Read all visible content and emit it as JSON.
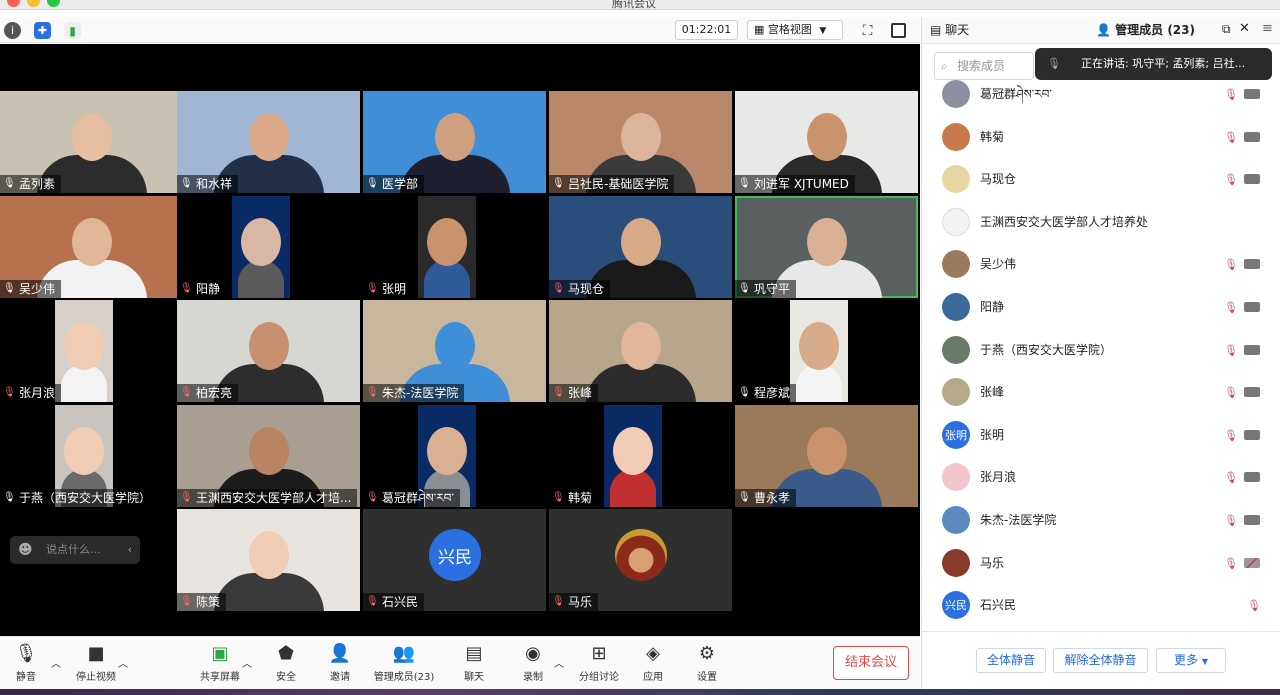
{
  "window": {
    "title": "腾讯会议"
  },
  "toolbar": {
    "timer": "01:22:01",
    "view_label": "宫格视图"
  },
  "tiles": [
    {
      "name": "孟列素",
      "bg": "#c9c2b3",
      "skin": "#e6bfa3",
      "cloth": "#2c2c2c",
      "mic": "on"
    },
    {
      "name": "和水祥",
      "bg": "#9fb7d4",
      "skin": "#d9a98a",
      "cloth": "#222f48",
      "mic": "on"
    },
    {
      "name": "医学部",
      "bg": "#3f8ed6",
      "skin": "#cfa080",
      "cloth": "#1e2030",
      "mic": "on"
    },
    {
      "name": "吕社民-基础医学院",
      "bg": "#b9876a",
      "skin": "#dcb39b",
      "cloth": "#3a3a3a",
      "mic": "on"
    },
    {
      "name": "刘进军 XJTUMED",
      "bg": "#e8e8e6",
      "skin": "#c9936e",
      "cloth": "#2a2a2a",
      "mic": "on"
    },
    {
      "name": "吴少伟",
      "bg": "#b8714f",
      "skin": "#e0b899",
      "cloth": "#f2f2f2",
      "mic": "on"
    },
    {
      "name": "阳静",
      "bg": "#0a2a66",
      "skin": "#d8b8a4",
      "cloth": "#5a5a5a",
      "mic": "off"
    },
    {
      "name": "张明",
      "bg": "#2a2a2a",
      "skin": "#c9936e",
      "cloth": "#2f5a9a",
      "mic": "off"
    },
    {
      "name": "马现仓",
      "bg": "#2b4d7c",
      "skin": "#d8ab88",
      "cloth": "#1a1a1a",
      "mic": "off"
    },
    {
      "name": "巩守平",
      "bg": "#5a5f60",
      "skin": "#d9b192",
      "cloth": "#e8e8e8",
      "mic": "on"
    },
    {
      "name": "张月浪",
      "bg": "#d7cfc9",
      "skin": "#f0cdb4",
      "cloth": "#f3f3f3",
      "mic": "off"
    },
    {
      "name": "柏宏亮",
      "bg": "#d6d6d2",
      "skin": "#c79071",
      "cloth": "#2d2d2d",
      "mic": "off"
    },
    {
      "name": "朱杰-法医学院",
      "bg": "#c8b79c",
      "skin": "#3f8fd8",
      "cloth": "#3f8fd8",
      "mic": "off"
    },
    {
      "name": "张峰",
      "bg": "#b7a58c",
      "skin": "#e0b79a",
      "cloth": "#2b2b2b",
      "mic": "off"
    },
    {
      "name": "程彦斌",
      "bg": "#e9e7e2",
      "skin": "#d8ab88",
      "cloth": "#f4f4f4",
      "mic": "on"
    },
    {
      "name": "于燕（西安交大医学院）",
      "bg": "#c9c4c0",
      "skin": "#f0cdb4",
      "cloth": "#6a6a6a",
      "mic": "on"
    },
    {
      "name": "王渊西安交大医学部人才培...",
      "bg": "#a89e92",
      "skin": "#b88462",
      "cloth": "#1c1c1c",
      "mic": "off"
    },
    {
      "name": "葛冠群ཤེས་རབ་",
      "bg": "#0a2a66",
      "skin": "#d9b192",
      "cloth": "#8a8f96",
      "mic": "off"
    },
    {
      "name": "韩菊",
      "bg": "#0a2a66",
      "skin": "#f0cdb4",
      "cloth": "#c03030",
      "mic": "off"
    },
    {
      "name": "曹永孝",
      "bg": "#9a7a5a",
      "skin": "#c9936e",
      "cloth": "#3a5a8a",
      "mic": "on"
    },
    {
      "name": "陈策",
      "bg": "#e8e3de",
      "skin": "#f0cdb4",
      "cloth": "#3a3a3a",
      "mic": "off"
    },
    {
      "name": "石兴民",
      "bg": "#2f2f2f",
      "avatar": "兴民",
      "mic": "off"
    },
    {
      "name": "马乐",
      "bg": "#2f2f2f",
      "avatar_img": true,
      "mic": "off"
    }
  ],
  "chat": {
    "placeholder": "说点什么..."
  },
  "bottombar": {
    "mute": "静音",
    "video": "停止视频",
    "share": "共享屏幕",
    "security": "安全",
    "invite": "邀请",
    "members": "管理成员(23)",
    "chat": "聊天",
    "record": "录制",
    "breakout": "分组讨论",
    "apps": "应用",
    "settings": "设置",
    "end": "结束会议"
  },
  "panel": {
    "chat_tab": "聊天",
    "members_tab": "管理成员 (23)",
    "search_placeholder": "搜索成员",
    "speaking": "正在讲话: 巩守平; 孟列素; 吕社...",
    "mute_all": "全体静音",
    "unmute_all": "解除全体静音",
    "more": "更多"
  },
  "members": [
    {
      "name": "葛冠群ཤེས་རབ་",
      "color": "#8b8fa0",
      "cam": "on"
    },
    {
      "name": "韩菊",
      "color": "#c97a4c",
      "cam": "on"
    },
    {
      "name": "马现仓",
      "color": "#e8d6a0",
      "cam": "on"
    },
    {
      "name": "王渊西安交大医学部人才培养处",
      "color": "#f2f2f2",
      "cam": "none"
    },
    {
      "name": "吴少伟",
      "color": "#9a7a5e",
      "cam": "on"
    },
    {
      "name": "阳静",
      "color": "#3a6a9a",
      "cam": "on"
    },
    {
      "name": "于燕（西安交大医学院）",
      "color": "#6a7a6a",
      "cam": "on"
    },
    {
      "name": "张峰",
      "color": "#b4aa8a",
      "cam": "on"
    },
    {
      "name": "张明",
      "color": "#2b6fe0",
      "initials": "张明",
      "cam": "on"
    },
    {
      "name": "张月浪",
      "color": "#f2c6cc",
      "cam": "on"
    },
    {
      "name": "朱杰-法医学院",
      "color": "#5a8ac0",
      "cam": "on"
    },
    {
      "name": "马乐",
      "color": "#8a3a2a",
      "cam": "off"
    },
    {
      "name": "石兴民",
      "color": "#2b6fe0",
      "initials": "兴民",
      "cam": "none"
    }
  ]
}
